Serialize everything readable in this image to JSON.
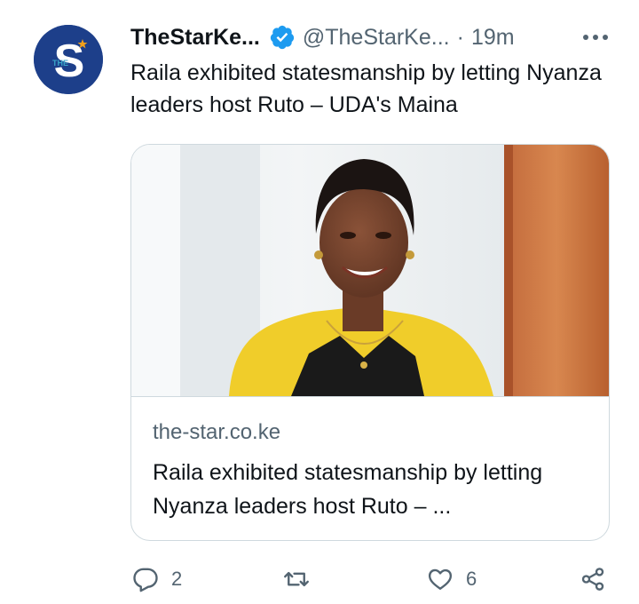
{
  "tweet": {
    "avatar": {
      "letter": "S",
      "tag": "THE"
    },
    "display_name": "TheStarKe...",
    "handle": "@TheStarKe...",
    "separator": "·",
    "time": "19m",
    "text": "Raila exhibited statesmanship by letting Nyanza leaders host Ruto – UDA's Maina"
  },
  "card": {
    "domain": "the-star.co.ke",
    "title": "Raila exhibited statesmanship by letting Nyanza leaders host Ruto – ..."
  },
  "actions": {
    "reply_count": "2",
    "like_count": "6"
  },
  "colors": {
    "avatar_bg": "#1d3f8a",
    "verified": "#1d9bf0",
    "muted": "#536471",
    "border": "#cfd9de"
  }
}
